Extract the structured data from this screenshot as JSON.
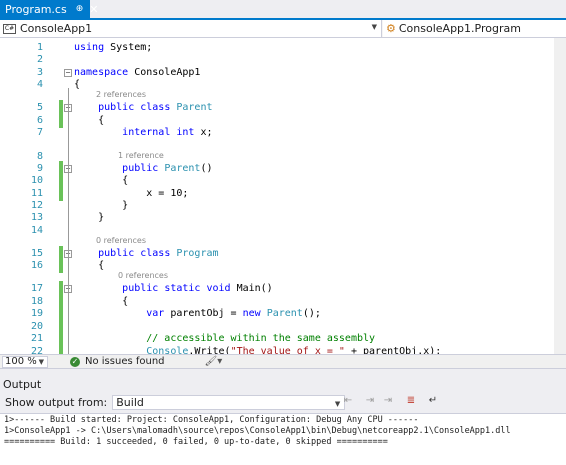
{
  "tab": {
    "title": "Program.cs",
    "pin": "⊕",
    "close": "✕"
  },
  "nav": {
    "project": "ConsoleApp1",
    "member": "ConsoleApp1.Program"
  },
  "editor": {
    "lines": [
      {
        "n": "1",
        "code": "<span class=\"kw\">using</span> System;"
      },
      {
        "n": "2",
        "code": ""
      },
      {
        "n": "3",
        "code": "<span class=\"kw\">namespace</span> ConsoleApp1"
      },
      {
        "n": "4",
        "code": "{"
      },
      {
        "n": "5",
        "code": "    <span class=\"kw\">public class</span> <span class=\"ty\">Parent</span>"
      },
      {
        "n": "6",
        "code": "    {"
      },
      {
        "n": "7",
        "code": "        <span class=\"kw\">internal int</span> x;"
      },
      {
        "n": "8",
        "code": ""
      },
      {
        "n": "9",
        "code": "        <span class=\"kw\">public</span> <span class=\"ty\">Parent</span>()"
      },
      {
        "n": "10",
        "code": "        {"
      },
      {
        "n": "11",
        "code": "            x = 10;"
      },
      {
        "n": "12",
        "code": "        }"
      },
      {
        "n": "13",
        "code": "    }"
      },
      {
        "n": "14",
        "code": ""
      },
      {
        "n": "15",
        "code": "    <span class=\"kw\">public class</span> <span class=\"ty\">Program</span>"
      },
      {
        "n": "16",
        "code": "    {"
      },
      {
        "n": "17",
        "code": "        <span class=\"kw\">public static void</span> Main()"
      },
      {
        "n": "18",
        "code": "        {"
      },
      {
        "n": "19",
        "code": "            <span class=\"kw\">var</span> parentObj = <span class=\"kw\">new</span> <span class=\"ty\">Parent</span>();"
      },
      {
        "n": "20",
        "code": ""
      },
      {
        "n": "21",
        "code": "            <span class=\"cm\">// accessible within the same assembly</span>"
      },
      {
        "n": "22",
        "code": "            <span class=\"ty\">Console</span>.Write(<span class=\"str\">\"The value of x = \"</span> + parentObj.x);"
      }
    ],
    "codelens": {
      "parent": "2 references",
      "ctor": "1 reference",
      "program": "0 references",
      "main": "0 references"
    }
  },
  "status": {
    "zoom": "100 %",
    "issues": "No issues found"
  },
  "output": {
    "title": "Output",
    "show_from_label": "Show output from:",
    "source": "Build",
    "lines": [
      "1>------ Build started: Project: ConsoleApp1, Configuration: Debug Any CPU ------",
      "1>ConsoleApp1 -> C:\\Users\\malomadh\\source\\repos\\ConsoleApp1\\bin\\Debug\\netcoreapp2.1\\ConsoleApp1.dll",
      "========== Build: 1 succeeded, 0 failed, 0 up-to-date, 0 skipped =========="
    ]
  }
}
